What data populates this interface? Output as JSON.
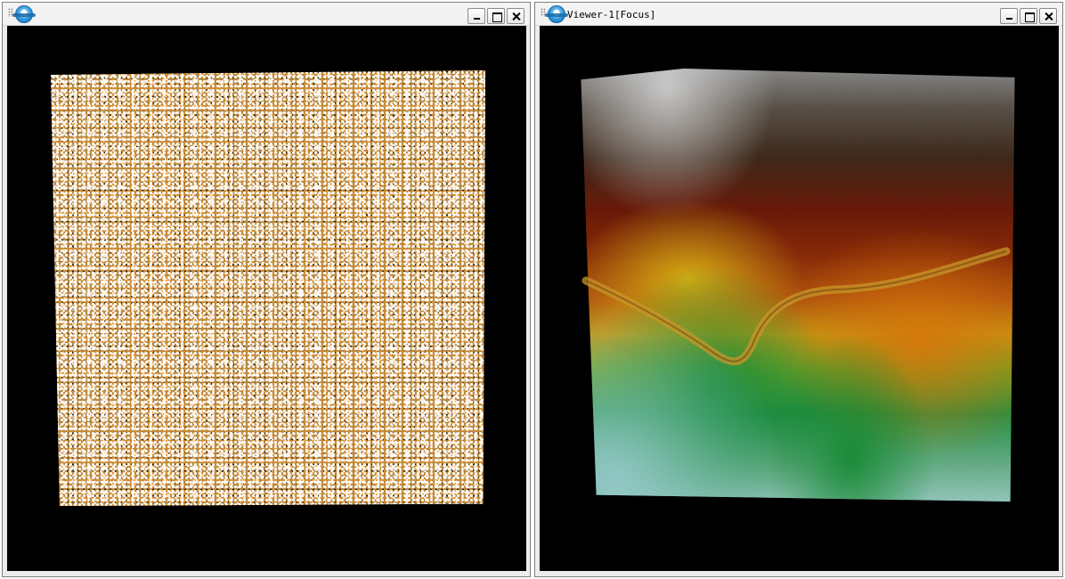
{
  "viewers": [
    {
      "title": "",
      "content": "point-cloud"
    },
    {
      "title": "Viewer-1[Focus]",
      "content": "shaded-elevation-model"
    }
  ],
  "colors": {
    "canvas_bg": "#000000",
    "titlebar_bg": "#f3f3f3",
    "point_white": "#ffffff",
    "point_orange": "#e8911a"
  },
  "icons": {
    "app_logo": "app-logo-icon",
    "minimize": "minimize-icon",
    "maximize": "maximize-icon",
    "close": "close-icon"
  }
}
